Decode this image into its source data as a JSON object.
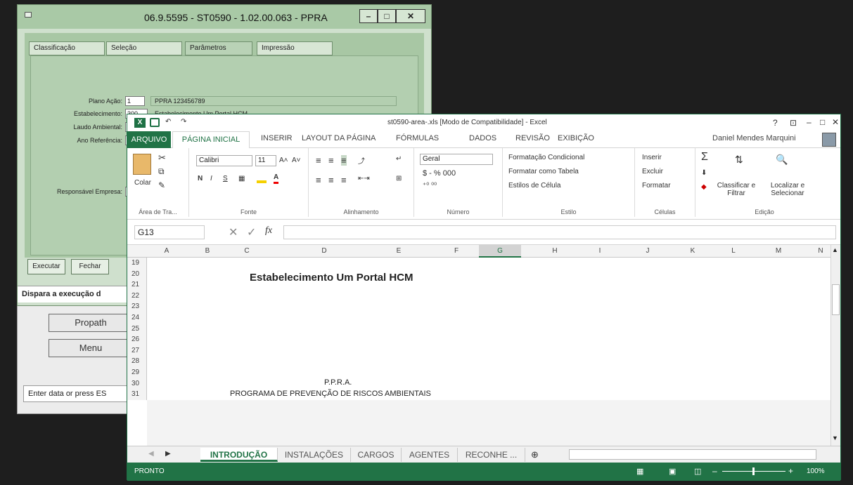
{
  "background_window": {
    "buttons": [
      "Propath",
      "Menu"
    ],
    "status": "Enter data or press ES"
  },
  "dialog": {
    "title": "06.9.5595 - ST0590 - 1.02.00.063 - PPRA",
    "window_buttons": [
      "–",
      "□",
      "✕"
    ],
    "tabs": [
      "Classificação",
      "Seleção",
      "Parâmetros",
      "Impressão"
    ],
    "fields": [
      {
        "label": "Plano Ação:",
        "value": "1",
        "display": "PPRA 123456789"
      },
      {
        "label": "Estabelecimento:",
        "value": "300",
        "display": "Estabelecimento Um Portal HCM"
      },
      {
        "label": "Laudo Ambiental:",
        "value": "",
        "display": ""
      },
      {
        "label": "Ano Referência:",
        "value": "",
        "display": ""
      },
      {
        "label": "Responsável Empresa:",
        "value": "",
        "display": ""
      }
    ],
    "buttons": [
      "Executar",
      "Fechar"
    ],
    "status": "Dispara a execução d"
  },
  "excel": {
    "qat": [
      "↶",
      "↷"
    ],
    "title": "st0590-area-.xls  [Modo de Compatibilidade] - Excel",
    "title_controls": [
      "?",
      "⊡",
      "–",
      "□",
      "✕"
    ],
    "user": "Daniel Mendes Marquini",
    "ribbon_tabs": [
      "ARQUIVO",
      "PÁGINA INICIAL",
      "INSERIR",
      "LAYOUT DA PÁGINA",
      "FÓRMULAS",
      "DADOS",
      "REVISÃO",
      "EXIBIÇÃO"
    ],
    "groups": {
      "clipboard": {
        "paste": "Colar",
        "label": "Área de Tra..."
      },
      "font": {
        "name": "Calibri",
        "size": "11",
        "bold": "N",
        "italic": "I",
        "underline": "S",
        "label": "Fonte"
      },
      "alignment": {
        "label": "Alinhamento"
      },
      "number": {
        "format": "Geral",
        "currency": "$ - % 000",
        "label": "Número"
      },
      "styles": {
        "items": [
          "Formatação Condicional",
          "Formatar como Tabela",
          "Estilos de Célula"
        ],
        "label": "Estilo"
      },
      "cells": {
        "items": [
          "Inserir",
          "Excluir",
          "Formatar"
        ],
        "label": "Células"
      },
      "editing": {
        "sort": "Classificar e Filtrar",
        "find": "Localizar e Selecionar",
        "label": "Edição"
      }
    },
    "namebox": "G13",
    "fx": "fx",
    "columns": [
      "A",
      "B",
      "C",
      "D",
      "E",
      "F",
      "G",
      "H",
      "I",
      "J",
      "K",
      "L",
      "M",
      "N"
    ],
    "rows": [
      "19",
      "20",
      "21",
      "22",
      "23",
      "24",
      "25",
      "26",
      "27",
      "28",
      "29",
      "30",
      "31"
    ],
    "cells": {
      "r20": "Estabelecimento Um Portal HCM",
      "r30": "P.P.R.A.",
      "r31": "PROGRAMA DE PREVENÇÃO DE RISCOS AMBIENTAIS"
    },
    "sheets": [
      "INTRODUÇÃO",
      "INSTALAÇÕES",
      "CARGOS",
      "AGENTES",
      "RECONHE ..."
    ],
    "status": "PRONTO",
    "zoom": "100%",
    "colors": {
      "green": "#217346",
      "accent": "#1e7145"
    }
  }
}
